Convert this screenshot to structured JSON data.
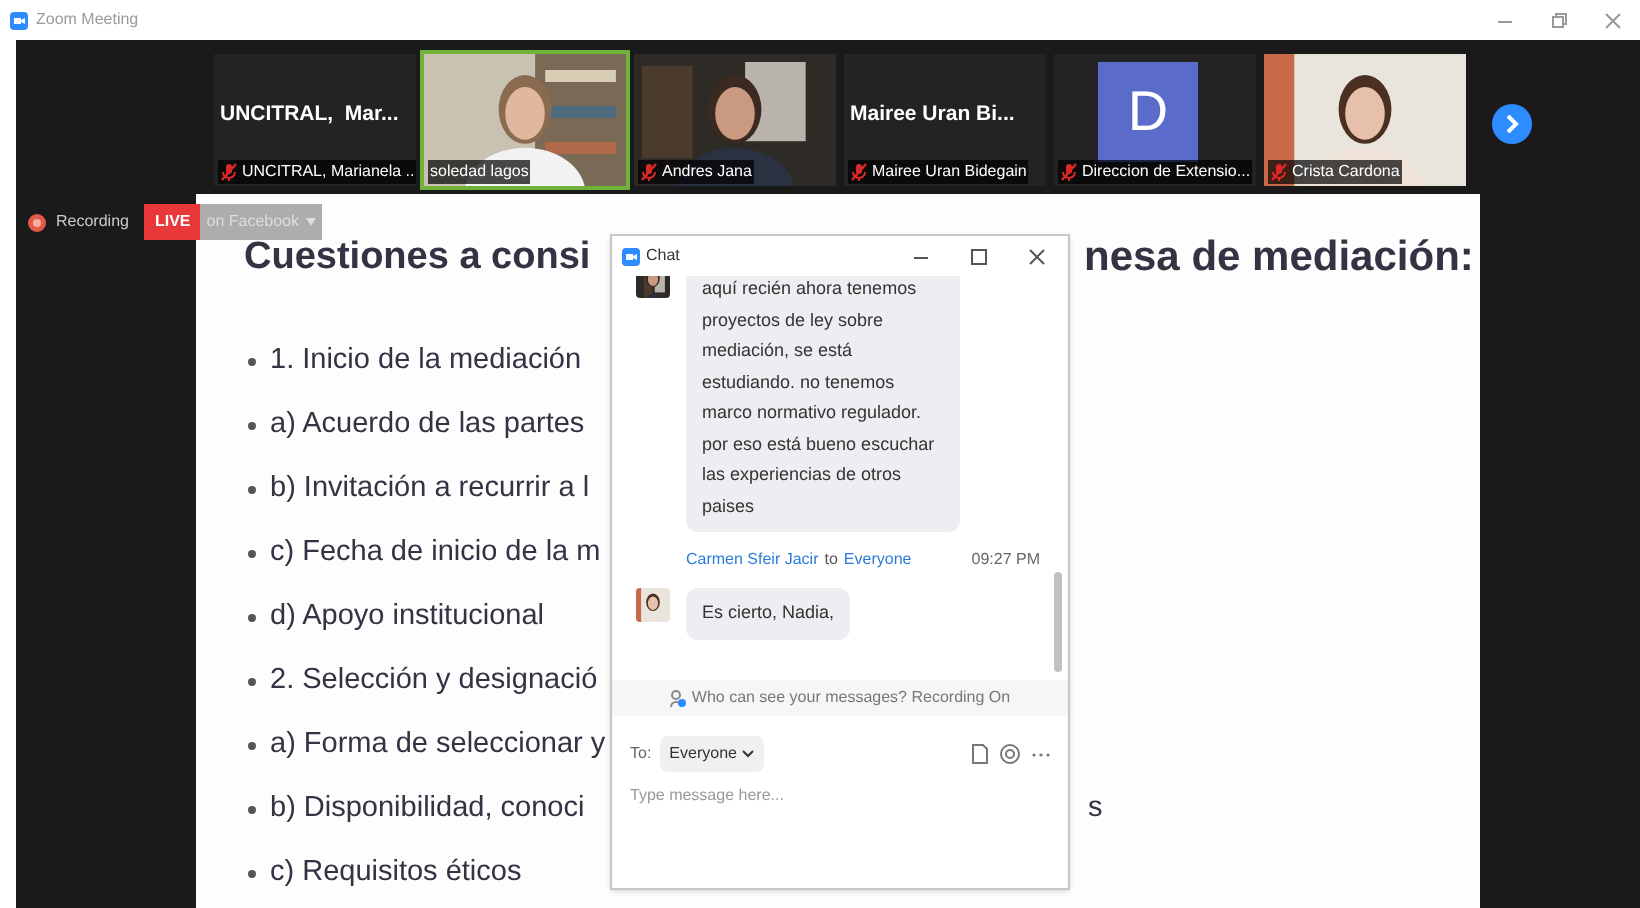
{
  "window": {
    "title": "Zoom Meeting"
  },
  "participants": [
    {
      "kind": "name",
      "display_name": "UNCITRAL,  Mar...",
      "label": "UNCITRAL, Marianela ...",
      "muted": true,
      "speaking": false
    },
    {
      "kind": "video",
      "label": "soledad lagos",
      "muted": false,
      "speaking": true
    },
    {
      "kind": "video",
      "label": "Andres Jana",
      "muted": true,
      "speaking": false
    },
    {
      "kind": "name",
      "display_name": "Mairee Uran Bi...",
      "label": "Mairee Uran Bidegain",
      "muted": true,
      "speaking": false
    },
    {
      "kind": "avatar",
      "initial": "D",
      "color": "#5b6bc9",
      "label": "Direccion de Extensio...",
      "muted": true,
      "speaking": false
    },
    {
      "kind": "video",
      "label": "Crista Cardona",
      "muted": true,
      "speaking": false
    }
  ],
  "recording": {
    "label": "Recording",
    "live_badge": "LIVE",
    "destination": "on Facebook"
  },
  "slide": {
    "title": "Cuestiones a consi",
    "title_tail": "nesa de mediación:",
    "bullets": [
      {
        "text": "1. Inicio de la mediación"
      },
      {
        "text": "a) Acuerdo de las partes"
      },
      {
        "text": "b) Invitación a recurrir a l"
      },
      {
        "text": "c) Fecha de inicio de la m"
      },
      {
        "text": "d) Apoyo institucional"
      },
      {
        "text": "2. Selección y designació"
      },
      {
        "text": "a) Forma de seleccionar y"
      },
      {
        "text": "b) Disponibilidad, conoci",
        "tail": "s"
      },
      {
        "text": "c) Requisitos éticos"
      }
    ]
  },
  "chat": {
    "title": "Chat",
    "messages": [
      {
        "text": "aquí recién ahora tenemos proyectos de ley sobre mediación, se está estudiando. no tenemos marco normativo regulador. por eso está bueno escuchar las experiencias de otros paises"
      },
      {
        "sender": "Carmen Sfeir Jacir",
        "to_word": "to",
        "recipient": "Everyone",
        "time": "09:27 PM",
        "text": "Es cierto, Nadia,"
      }
    ],
    "notice": "Who can see your messages? Recording On",
    "to_label": "To:",
    "to_value": "Everyone",
    "placeholder": "Type message here..."
  }
}
